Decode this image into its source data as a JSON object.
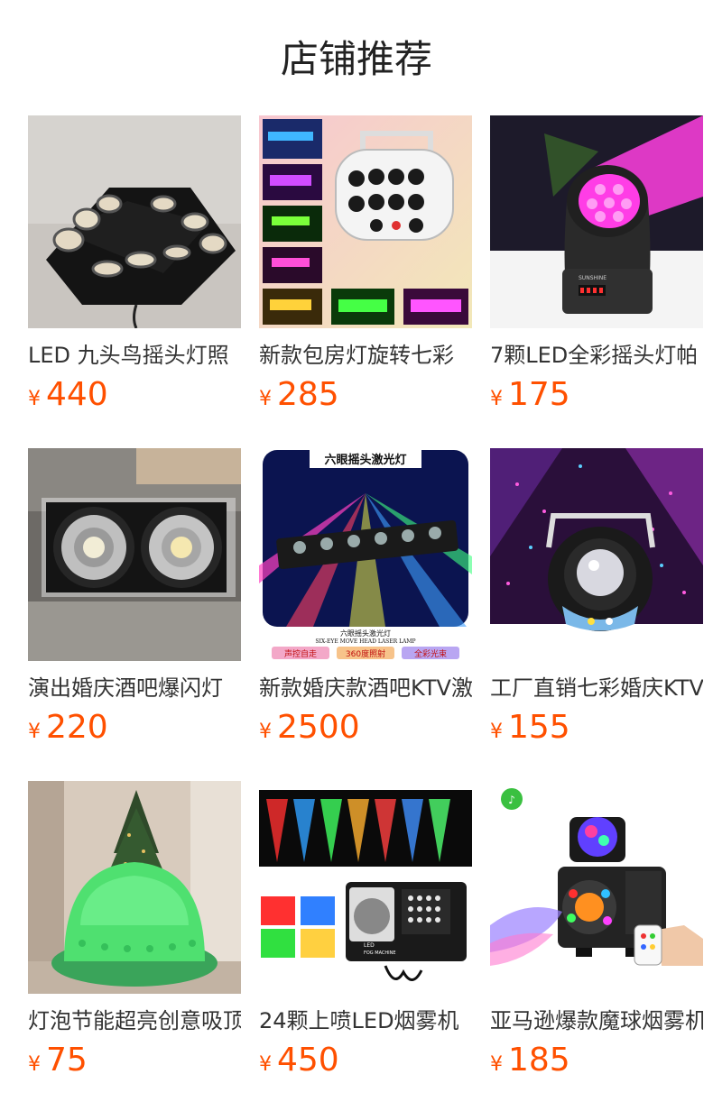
{
  "shop": {
    "title": "店铺推荐"
  },
  "currency": "¥",
  "products": [
    {
      "name": "LED 九头鸟摇头灯照",
      "price": "440",
      "image": "nine-head-bird-moving-light"
    },
    {
      "name": "新款包房灯旋转七彩",
      "price": "285",
      "image": "white-derby-effect-light"
    },
    {
      "name": "7颗LED全彩摇头灯帕",
      "price": "175",
      "image": "led-moving-head-wash-light"
    },
    {
      "name": "演出婚庆酒吧爆闪灯",
      "price": "220",
      "image": "two-eye-cob-blinder"
    },
    {
      "name": "新款婚庆款酒吧KTV激",
      "price": "2500",
      "image": "six-eye-moving-head-laser"
    },
    {
      "name": "工厂直销七彩婚庆KTV",
      "price": "155",
      "image": "crystal-magic-ball-light"
    },
    {
      "name": "灯泡节能超亮创意吸顶",
      "price": "75",
      "image": "green-led-dome-lamp"
    },
    {
      "name": "24颗上喷LED烟雾机",
      "price": "450",
      "image": "led-fog-machine"
    },
    {
      "name": "亚马逊爆款魔球烟雾机",
      "price": "185",
      "image": "magic-ball-fog-machine"
    }
  ],
  "image_texts": {
    "laser_banner": "六眼摇头激光灯",
    "laser_caption_cn": "六眼摇头激光灯",
    "laser_caption_en": "SIX-EYE MOVE HEAD LASER LAMP",
    "laser_tag_1": "声控自走",
    "laser_tag_2": "360度照射",
    "laser_tag_3": "全彩光束",
    "moving_head_brand": "SUNSHINE",
    "fog_label_1": "LED",
    "fog_label_2": "FOG MACHINE"
  }
}
